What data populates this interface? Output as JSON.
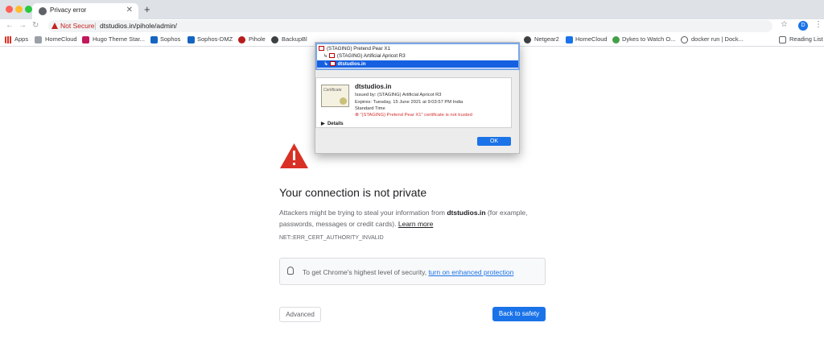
{
  "browser": {
    "tab_title": "Privacy error",
    "security_label": "Not Secure",
    "url": "dtstudios.in/pihole/admin/",
    "avatar_letter": "D"
  },
  "bookmarks": [
    {
      "label": "Apps",
      "icon": "apps-grid-icon"
    },
    {
      "label": "HomeCloud",
      "icon": "folder-icon"
    },
    {
      "label": "Hugo Theme Star...",
      "icon": "hugo-icon"
    },
    {
      "label": "Sophos",
      "icon": "sophos-icon"
    },
    {
      "label": "Sophos-DMZ",
      "icon": "sophos-icon"
    },
    {
      "label": "Pihole",
      "icon": "pihole-icon"
    },
    {
      "label": "BackupBl",
      "icon": "globe-icon"
    },
    {
      "label": "Netgear2",
      "icon": "globe-icon"
    },
    {
      "label": "HomeCloud",
      "icon": "document-icon"
    },
    {
      "label": "Dykes to Watch O...",
      "icon": "green-circle-icon"
    },
    {
      "label": "docker run | Dock...",
      "icon": "docker-icon"
    },
    {
      "label": "Reading List",
      "icon": "reading-list-icon"
    }
  ],
  "page": {
    "heading": "Your connection is not private",
    "para_before": "Attackers might be trying to steal your information from ",
    "para_domain": "dtstudios.in",
    "para_after": " (for example, passwords, messages or credit cards). ",
    "learn_more": "Learn more",
    "error_code": "NET::ERR_CERT_AUTHORITY_INVALID",
    "security_text": "To get Chrome's highest level of security, ",
    "security_link": "turn on enhanced protection",
    "advanced_label": "Advanced",
    "back_label": "Back to safety"
  },
  "certificate_dialog": {
    "chain": [
      "(STAGING) Pretend Pear X1",
      "(STAGING) Artificial Apricot R3",
      "dtstudios.in"
    ],
    "image_text": "Certificate",
    "name": "dtstudios.in",
    "issued_by": "Issued by: (STAGING) Artificial Apricot R3",
    "expires": "Expires: Tuesday, 15 June 2021 at 9:03:57 PM India",
    "timezone": "Standard Time",
    "warning": "\"(STAGING) Pretend Pear X1\" certificate is not trusted",
    "details_label": "Details",
    "ok_label": "OK"
  },
  "colors": {
    "accent": "#1a73e8",
    "danger": "#d93025"
  }
}
